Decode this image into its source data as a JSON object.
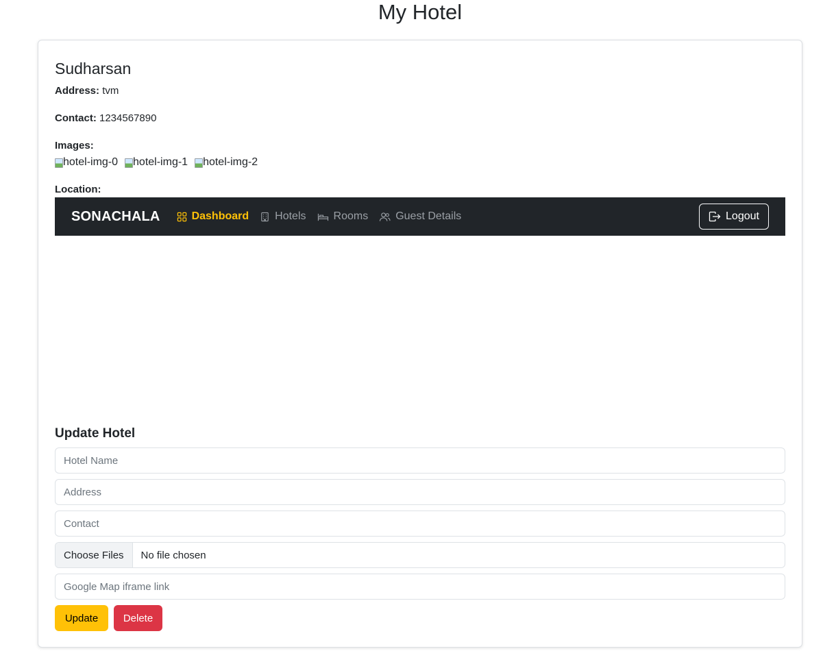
{
  "page": {
    "title": "My Hotel"
  },
  "hotel": {
    "name": "Sudharsan",
    "address_label": "Address:",
    "address": "tvm",
    "contact_label": "Contact:",
    "contact": "1234567890",
    "images_label": "Images:",
    "images": [
      "hotel-img-0",
      "hotel-img-1",
      "hotel-img-2"
    ],
    "location_label": "Location:"
  },
  "navbar": {
    "brand": "SONACHALA",
    "items": [
      {
        "label": "Dashboard",
        "icon": "grid-icon",
        "active": true
      },
      {
        "label": "Hotels",
        "icon": "building-icon",
        "active": false
      },
      {
        "label": "Rooms",
        "icon": "bed-icon",
        "active": false
      },
      {
        "label": "Guest Details",
        "icon": "people-icon",
        "active": false
      }
    ],
    "logout_label": "Logout",
    "bg_color": "#212529",
    "active_color": "#ffc107"
  },
  "form": {
    "title": "Update Hotel",
    "name_placeholder": "Hotel Name",
    "address_placeholder": "Address",
    "contact_placeholder": "Contact",
    "file_button": "Choose Files",
    "file_status": "No file chosen",
    "map_placeholder": "Google Map iframe link",
    "update_label": "Update",
    "delete_label": "Delete",
    "update_color": "#ffc107",
    "delete_color": "#dc3545"
  }
}
